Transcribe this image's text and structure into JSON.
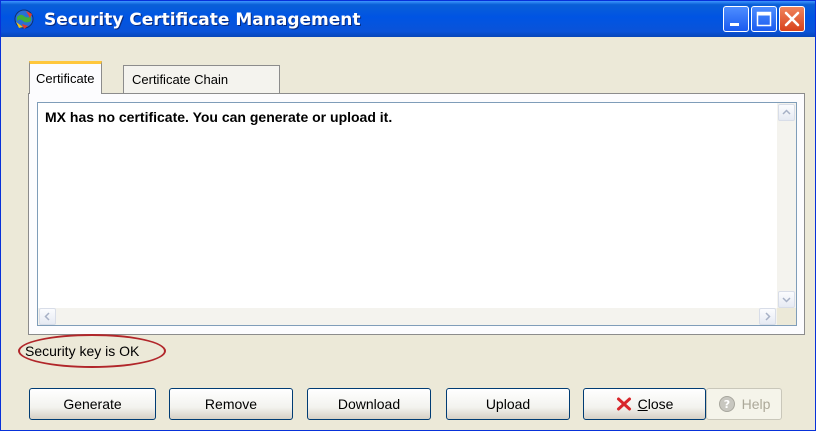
{
  "window": {
    "title": "Security Certificate Management"
  },
  "tabs": [
    {
      "label": "Certificate",
      "active": true
    },
    {
      "label": "Certificate Chain",
      "active": false
    }
  ],
  "certificate": {
    "message": "MX has no certificate. You can generate or upload it."
  },
  "status": {
    "text": "Security key is OK"
  },
  "buttons": {
    "generate": "Generate",
    "remove": "Remove",
    "download": "Download",
    "upload": "Upload",
    "close_mnemonic": "C",
    "close_rest": "lose",
    "help": "Help"
  },
  "icons": {
    "app": "security-globe-icon",
    "close": "red-x-icon",
    "help": "help-icon"
  },
  "colors": {
    "titlebar": "#0054e3",
    "highlight_ring": "#b1262a",
    "active_tab_accent": "#ffc73c"
  }
}
